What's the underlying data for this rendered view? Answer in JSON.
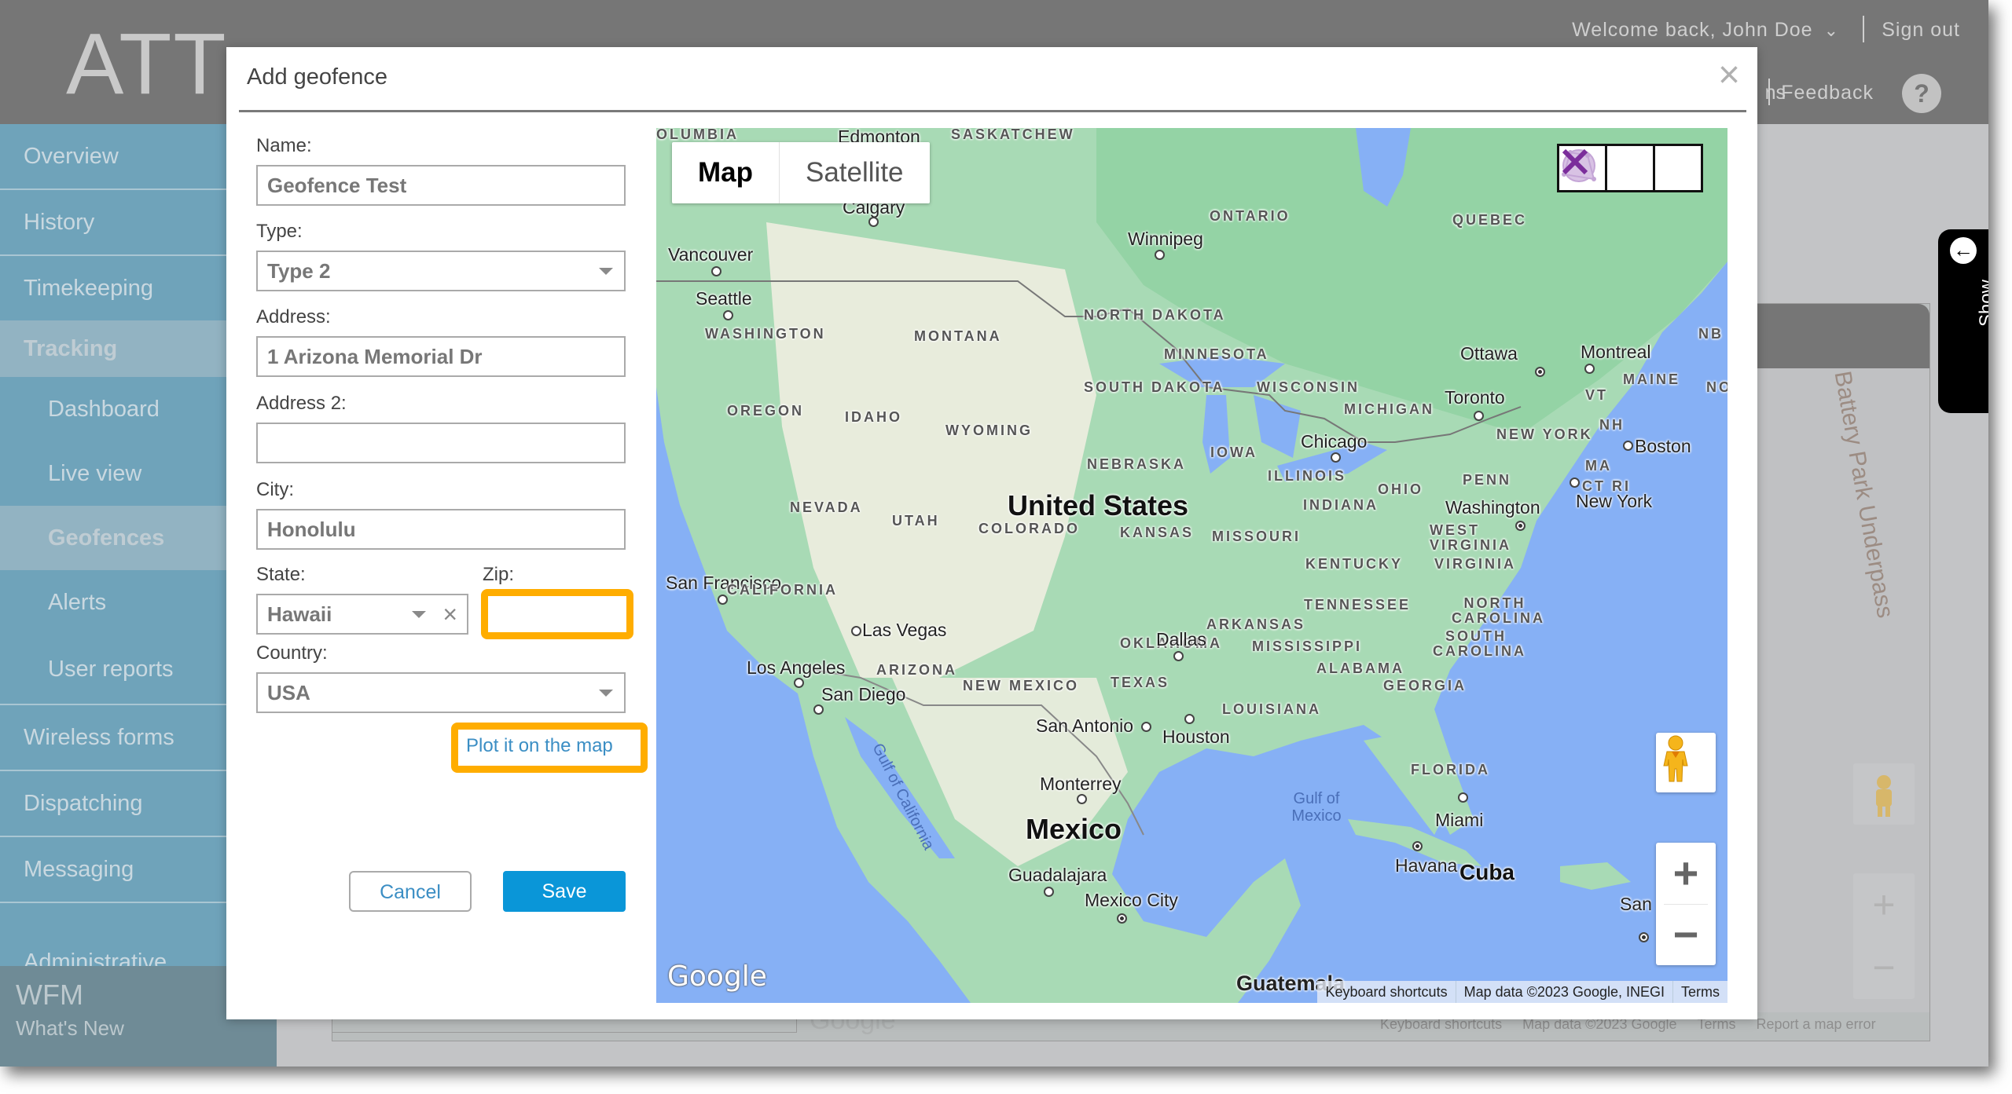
{
  "header": {
    "logo": "ATT",
    "welcome": "Welcome back, John Doe",
    "sign_out": "Sign out",
    "hidden_link_fragment": "ns",
    "feedback": "Feedback",
    "help": "?"
  },
  "sidebar": {
    "items": [
      {
        "label": "Overview",
        "chevron": ""
      },
      {
        "label": "History",
        "chevron": "›"
      },
      {
        "label": "Timekeeping",
        "chevron": "›"
      },
      {
        "label": "Tracking",
        "chevron": "›"
      },
      {
        "label": "Dashboard"
      },
      {
        "label": "Live view"
      },
      {
        "label": "Geofences"
      },
      {
        "label": "Alerts"
      },
      {
        "label": "User reports"
      },
      {
        "label": "Wireless forms",
        "chevron": "›"
      },
      {
        "label": "Dispatching",
        "chevron": "›"
      },
      {
        "label": "Messaging",
        "chevron": ""
      },
      {
        "label": "Administrative",
        "chevron": "›"
      }
    ],
    "footer": {
      "product": "WFM",
      "whats_new": "What's New"
    }
  },
  "background": {
    "street_label": "Battery Park Underpass",
    "show_tab": "Show",
    "footer": [
      "Keyboard shortcuts",
      "Map data ©2023 Google",
      "Terms",
      "Report a map error"
    ],
    "google": "Google"
  },
  "dialog": {
    "title": "Add geofence",
    "close": "×",
    "form": {
      "name_label": "Name:",
      "name_value": "Geofence Test",
      "type_label": "Type:",
      "type_value": "Type 2",
      "address_label": "Address:",
      "address_value": "1 Arizona Memorial Dr",
      "address2_label": "Address 2:",
      "address2_value": "",
      "city_label": "City:",
      "city_value": "Honolulu",
      "state_label": "State:",
      "state_value": "Hawaii",
      "zip_label": "Zip:",
      "zip_value": "",
      "country_label": "Country:",
      "country_value": "USA",
      "plot_link": "Plot it on the map",
      "cancel": "Cancel",
      "save": "Save"
    },
    "highlight_color": "#ffad00"
  },
  "map": {
    "type_buttons": {
      "map": "Map",
      "satellite": "Satellite"
    },
    "active_type": "Map",
    "draw_tools": [
      "circle-tool",
      "polygon-tool",
      "delete-tool"
    ],
    "google": "Google",
    "attribution": [
      "Keyboard shortcuts",
      "Map data ©2023 Google, INEGI",
      "Terms"
    ],
    "labels": {
      "countries": [
        {
          "text": "United States"
        },
        {
          "text": "Mexico"
        },
        {
          "text": "Cuba"
        }
      ],
      "cities": [
        {
          "text": "Edmonton"
        },
        {
          "text": "Calgary"
        },
        {
          "text": "Vancouver"
        },
        {
          "text": "Seattle"
        },
        {
          "text": "Winnipeg"
        },
        {
          "text": "Ottawa"
        },
        {
          "text": "Montreal"
        },
        {
          "text": "Toronto"
        },
        {
          "text": "Boston"
        },
        {
          "text": "New York"
        },
        {
          "text": "Washington"
        },
        {
          "text": "Chicago"
        },
        {
          "text": "San Francisco"
        },
        {
          "text": "Las Vegas"
        },
        {
          "text": "Los Angeles"
        },
        {
          "text": "San Diego"
        },
        {
          "text": "Dallas"
        },
        {
          "text": "San Antonio"
        },
        {
          "text": "Houston"
        },
        {
          "text": "Monterrey"
        },
        {
          "text": "Guadalajara"
        },
        {
          "text": "Mexico City"
        },
        {
          "text": "Miami"
        },
        {
          "text": "Havana"
        },
        {
          "text": "Guatemala"
        },
        {
          "text": "San Domi"
        }
      ],
      "regions": [
        {
          "text": "OLUMBIA"
        },
        {
          "text": "SASKATCHEW"
        },
        {
          "text": "ONTARIO"
        },
        {
          "text": "QUEBEC"
        },
        {
          "text": "WASHINGTON"
        },
        {
          "text": "MONTANA"
        },
        {
          "text": "NORTH DAKOTA"
        },
        {
          "text": "MINNESOTA"
        },
        {
          "text": "SOUTH DAKOTA"
        },
        {
          "text": "WISCONSIN"
        },
        {
          "text": "MICHIGAN"
        },
        {
          "text": "OREGON"
        },
        {
          "text": "IDAHO"
        },
        {
          "text": "WYOMING"
        },
        {
          "text": "NEBRASKA"
        },
        {
          "text": "IOWA"
        },
        {
          "text": "ILLINOIS"
        },
        {
          "text": "INDIANA"
        },
        {
          "text": "OHIO"
        },
        {
          "text": "PENN"
        },
        {
          "text": "NEW YORK"
        },
        {
          "text": "VT"
        },
        {
          "text": "NH"
        },
        {
          "text": "MAINE"
        },
        {
          "text": "MA"
        },
        {
          "text": "CT RI"
        },
        {
          "text": "NB"
        },
        {
          "text": "NO"
        },
        {
          "text": "NEVADA"
        },
        {
          "text": "UTAH"
        },
        {
          "text": "COLORADO"
        },
        {
          "text": "KANSAS"
        },
        {
          "text": "MISSOURI"
        },
        {
          "text": "KENTUCKY"
        },
        {
          "text": "WEST VIRGINIA"
        },
        {
          "text": "VIRGINIA"
        },
        {
          "text": "CALIFORNIA"
        },
        {
          "text": "ARIZONA"
        },
        {
          "text": "NEW MEXICO"
        },
        {
          "text": "OKLAHOMA"
        },
        {
          "text": "TENNESSEE"
        },
        {
          "text": "NORTH CAROLINA"
        },
        {
          "text": "ARKANSAS"
        },
        {
          "text": "MISSISSIPPI"
        },
        {
          "text": "SOUTH CAROLINA"
        },
        {
          "text": "ALABAMA"
        },
        {
          "text": "GEORGIA"
        },
        {
          "text": "TEXAS"
        },
        {
          "text": "LOUISIANA"
        },
        {
          "text": "FLORIDA"
        }
      ],
      "water": [
        {
          "text": "Gulf of California"
        },
        {
          "text": "Gulf of Mexico"
        }
      ]
    }
  },
  "colors": {
    "header_bg": "#767676",
    "sidebar_bg": "#6fa3ba",
    "save_button": "#0a96d8",
    "link": "#3b8ec4",
    "draw_tool_purple": "#7b2d9b",
    "water": "#86b0f5",
    "land": "#a8dab5"
  }
}
